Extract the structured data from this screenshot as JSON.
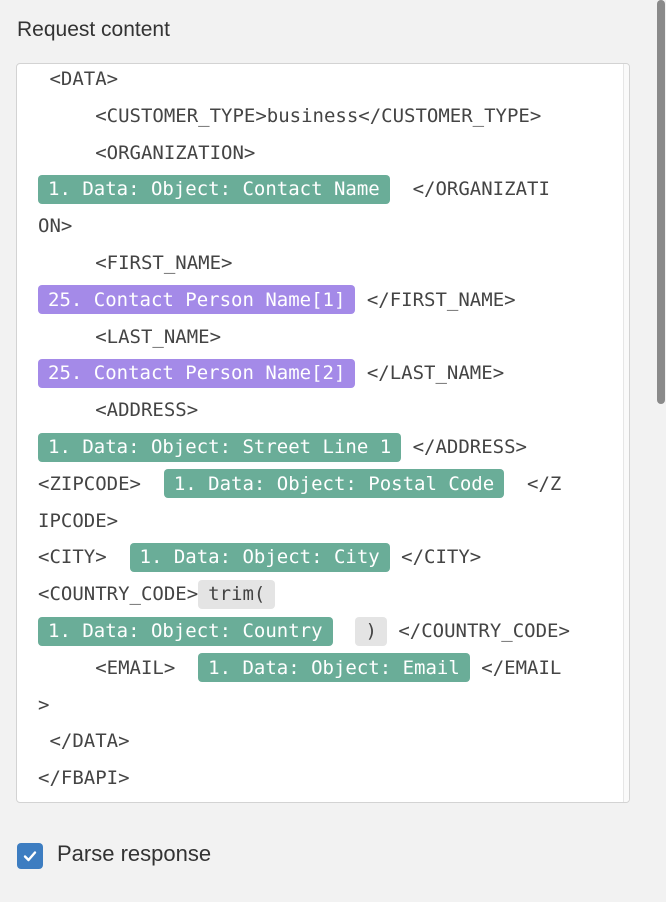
{
  "section_label": "Request content",
  "editor_lines": [
    {
      "parts": [
        {
          "t": "text",
          "v": " <DATA>"
        }
      ]
    },
    {
      "parts": [
        {
          "t": "text",
          "v": "     <CUSTOMER_TYPE>business</CUSTOMER_TYPE>"
        }
      ]
    },
    {
      "parts": [
        {
          "t": "text",
          "v": "     <ORGANIZATION>"
        }
      ]
    },
    {
      "parts": [
        {
          "t": "pill",
          "c": "green",
          "v": "1. Data: Object: Contact Name"
        },
        {
          "t": "text",
          "v": "  </ORGANIZATI"
        }
      ]
    },
    {
      "parts": [
        {
          "t": "text",
          "v": "ON>"
        }
      ]
    },
    {
      "parts": [
        {
          "t": "text",
          "v": "     <FIRST_NAME>"
        }
      ]
    },
    {
      "parts": [
        {
          "t": "pill",
          "c": "purple",
          "v": "25. Contact Person Name[1]"
        },
        {
          "t": "text",
          "v": " </FIRST_NAME>"
        }
      ]
    },
    {
      "parts": [
        {
          "t": "text",
          "v": "     <LAST_NAME>"
        }
      ]
    },
    {
      "parts": [
        {
          "t": "pill",
          "c": "purple",
          "v": "25. Contact Person Name[2]"
        },
        {
          "t": "text",
          "v": " </LAST_NAME>"
        }
      ]
    },
    {
      "parts": [
        {
          "t": "text",
          "v": "     <ADDRESS>"
        }
      ]
    },
    {
      "parts": [
        {
          "t": "pill",
          "c": "green",
          "v": "1. Data: Object: Street Line 1"
        },
        {
          "t": "text",
          "v": " </ADDRESS>"
        }
      ]
    },
    {
      "parts": [
        {
          "t": "text",
          "v": "<ZIPCODE>  "
        },
        {
          "t": "pill",
          "c": "green",
          "v": "1. Data: Object: Postal Code"
        },
        {
          "t": "text",
          "v": "  </Z"
        }
      ]
    },
    {
      "parts": [
        {
          "t": "text",
          "v": "IPCODE>"
        }
      ]
    },
    {
      "parts": [
        {
          "t": "text",
          "v": "<CITY>  "
        },
        {
          "t": "pill",
          "c": "green",
          "v": "1. Data: Object: City"
        },
        {
          "t": "text",
          "v": " </CITY>"
        }
      ]
    },
    {
      "parts": [
        {
          "t": "text",
          "v": "<COUNTRY_CODE>"
        },
        {
          "t": "pill",
          "c": "gray",
          "v": "trim("
        }
      ]
    },
    {
      "parts": [
        {
          "t": "pill",
          "c": "green",
          "v": "1. Data: Object: Country"
        },
        {
          "t": "text",
          "v": "  "
        },
        {
          "t": "pill",
          "c": "gray",
          "v": ")"
        },
        {
          "t": "text",
          "v": " </COUNTRY_CODE>"
        }
      ]
    },
    {
      "parts": [
        {
          "t": "text",
          "v": "     <EMAIL>  "
        },
        {
          "t": "pill",
          "c": "green",
          "v": "1. Data: Object: Email"
        },
        {
          "t": "text",
          "v": " </EMAIL"
        }
      ]
    },
    {
      "parts": [
        {
          "t": "text",
          "v": ">"
        }
      ]
    },
    {
      "parts": [
        {
          "t": "text",
          "v": " </DATA>"
        }
      ]
    },
    {
      "parts": [
        {
          "t": "text",
          "v": "</FBAPI>"
        }
      ]
    }
  ],
  "parse_response": {
    "label": "Parse response",
    "checked": true
  },
  "colors": {
    "pill_green": "#6aad98",
    "pill_purple": "#a48ae8",
    "pill_gray": "#e4e4e4",
    "checkbox": "#3d7dc1"
  }
}
